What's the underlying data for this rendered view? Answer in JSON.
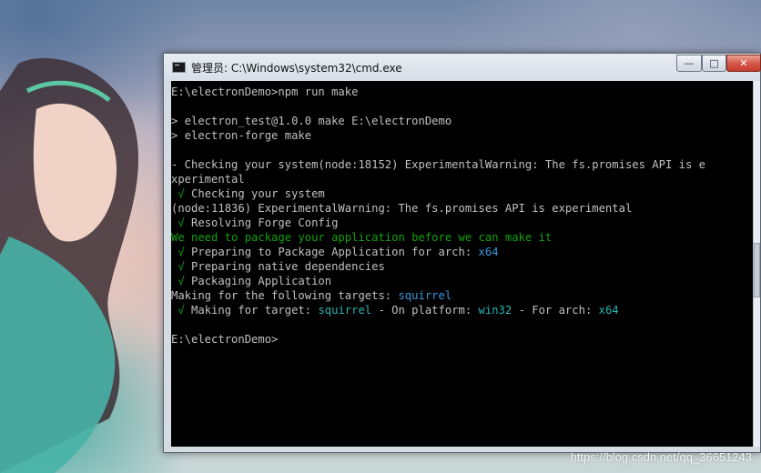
{
  "window": {
    "title": "管理员: C:\\Windows\\system32\\cmd.exe",
    "controls": {
      "minimize": "—",
      "maximize": "□",
      "close": "✕"
    }
  },
  "console": {
    "lines": [
      [
        {
          "t": "E:\\electronDemo>npm run make",
          "c": "default"
        }
      ],
      [
        {
          "t": "",
          "c": "default"
        }
      ],
      [
        {
          "t": "> electron_test@1.0.0 make E:\\electronDemo",
          "c": "default"
        }
      ],
      [
        {
          "t": "> electron-forge make",
          "c": "default"
        }
      ],
      [
        {
          "t": "",
          "c": "default"
        }
      ],
      [
        {
          "t": "- Checking your system(node:18152) ExperimentalWarning: The fs.promises API is e",
          "c": "default"
        }
      ],
      [
        {
          "t": "xperimental",
          "c": "default"
        }
      ],
      [
        {
          "t": " √",
          "c": "green"
        },
        {
          "t": " Checking your system",
          "c": "default"
        }
      ],
      [
        {
          "t": "(node:11836) ExperimentalWarning: The fs.promises API is experimental",
          "c": "default"
        }
      ],
      [
        {
          "t": " √",
          "c": "green"
        },
        {
          "t": " Resolving Forge Config",
          "c": "default"
        }
      ],
      [
        {
          "t": "We need to package your application before we can make it",
          "c": "green"
        }
      ],
      [
        {
          "t": " √",
          "c": "green"
        },
        {
          "t": " Preparing to Package Application for arch: ",
          "c": "default"
        },
        {
          "t": "x64",
          "c": "cyan"
        }
      ],
      [
        {
          "t": " √",
          "c": "green"
        },
        {
          "t": " Preparing native dependencies",
          "c": "default"
        }
      ],
      [
        {
          "t": " √",
          "c": "green"
        },
        {
          "t": " Packaging Application",
          "c": "default"
        }
      ],
      [
        {
          "t": "Making for the following targets: ",
          "c": "default"
        },
        {
          "t": "squirrel",
          "c": "cyan"
        }
      ],
      [
        {
          "t": " √",
          "c": "green"
        },
        {
          "t": " Making for target: ",
          "c": "default"
        },
        {
          "t": "squirrel",
          "c": "cyan2"
        },
        {
          "t": " - On platform: ",
          "c": "default"
        },
        {
          "t": "win32",
          "c": "cyan2"
        },
        {
          "t": " - For arch: ",
          "c": "default"
        },
        {
          "t": "x64",
          "c": "cyan2"
        }
      ],
      [
        {
          "t": "",
          "c": "default"
        }
      ],
      [
        {
          "t": "E:\\electronDemo>",
          "c": "default"
        }
      ]
    ]
  },
  "watermark": "https://blog.csdn.net/qq_36651243",
  "colors": {
    "console_bg": "#000000",
    "console_text": "#c0c0c0",
    "success_green": "#13a10e",
    "value_cyan": "#3a96dd"
  },
  "icons": {
    "window_icon": "cmd-console-icon",
    "minimize": "minimize-icon",
    "maximize": "maximize-icon",
    "close": "close-icon"
  }
}
